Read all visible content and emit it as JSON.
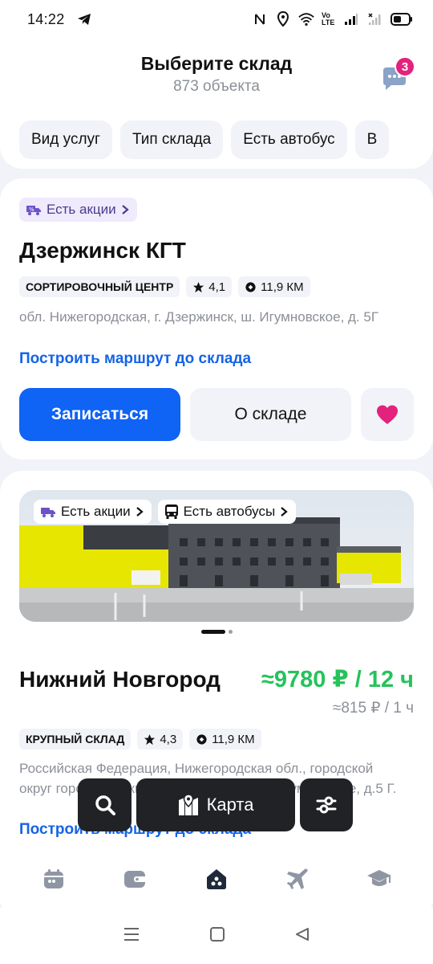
{
  "status_bar": {
    "time": "14:22",
    "battery_text": "Vo LTE"
  },
  "header": {
    "title": "Выберите склад",
    "subtitle": "873 объекта",
    "chat_badge_count": "3"
  },
  "filters": [
    "Вид услуг",
    "Тип склада",
    "Есть автобус",
    "В"
  ],
  "warehouses": [
    {
      "promo": "Есть акции",
      "name": "Дзержинск КГТ",
      "type": "Сортировочный центр",
      "rating": "4,1",
      "distance": "11,9 КМ",
      "address": "обл. Нижегородская, г. Дзержинск, ш. Игумновское, д. 5Г",
      "route_link": "Построить маршрут до склада",
      "signup_button": "Записаться",
      "about_button": "О складе"
    },
    {
      "photo_badges": [
        "Есть акции",
        "Есть автобусы"
      ],
      "name": "Нижний Новгород",
      "price_main": "≈9780 ₽ / 12 ч",
      "price_sub": "≈815 ₽ / 1 ч",
      "type": "Крупный склад",
      "rating": "4,3",
      "distance": "11,9 КМ",
      "address": "Российская Федерация, Нижегородская обл., городской округ город Дзержинск, г. Дзержинск, ш. Игумновское, д.5 Г.",
      "route_link": "Построить маршрут до склада"
    }
  ],
  "floating_bar": {
    "map_label": "Карта"
  },
  "colors": {
    "primary": "#0f63f5",
    "price_green": "#25c35a",
    "accent_pink": "#e3227c",
    "link": "#1463e6"
  }
}
